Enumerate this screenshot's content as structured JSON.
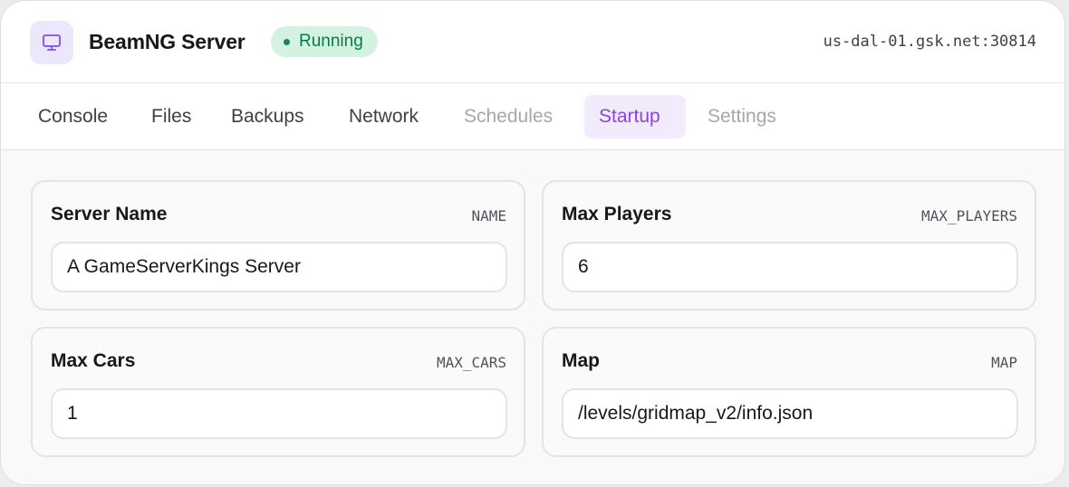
{
  "header": {
    "app_icon": "monitor-icon",
    "title": "BeamNG Server",
    "status": {
      "label": "Running",
      "color": "#0b7a48"
    },
    "host": "us-dal-01.gsk.net:30814"
  },
  "tabs": [
    {
      "label": "Console",
      "state": "enabled"
    },
    {
      "label": "Files",
      "state": "enabled"
    },
    {
      "label": "Backups",
      "state": "enabled"
    },
    {
      "label": "Network",
      "state": "enabled"
    },
    {
      "label": "Schedules",
      "state": "disabled"
    },
    {
      "label": "Startup",
      "state": "active"
    },
    {
      "label": "Settings",
      "state": "disabled"
    }
  ],
  "variables": [
    {
      "label": "Server Name",
      "env": "NAME",
      "value": "A GameServerKings Server"
    },
    {
      "label": "Max Players",
      "env": "MAX_PLAYERS",
      "value": "6"
    },
    {
      "label": "Max Cars",
      "env": "MAX_CARS",
      "value": "1"
    },
    {
      "label": "Map",
      "env": "MAP",
      "value": "/levels/gridmap_v2/info.json"
    }
  ],
  "colors": {
    "accent": "#8a44e0",
    "accent_bg": "#f1ebfd",
    "status_bg": "#d3f2e2"
  }
}
